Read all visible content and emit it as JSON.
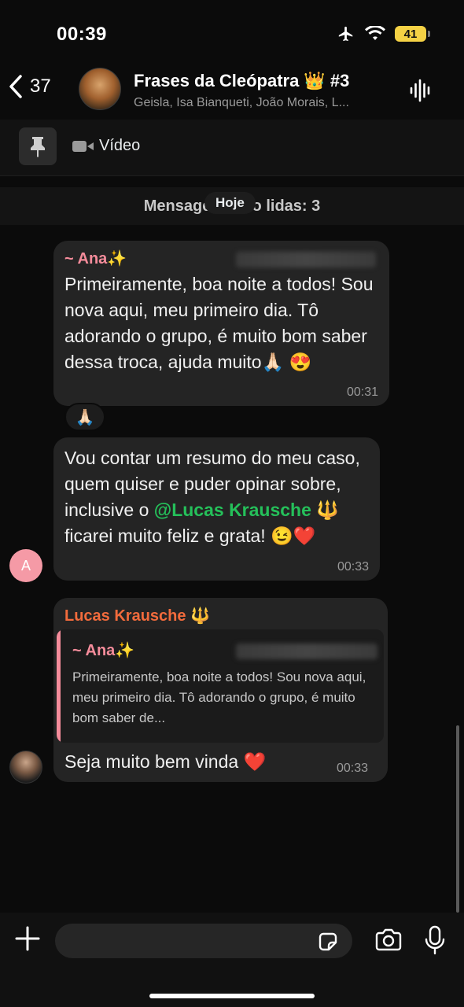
{
  "status_bar": {
    "time": "00:39",
    "battery": "41"
  },
  "header": {
    "back_count": "37",
    "title": "Frases da Cleópatra 👑 #3",
    "members": "Geisla, Isa Bianqueti, João Morais, L..."
  },
  "pinned": {
    "label": "Vídeo"
  },
  "unread": {
    "text": "Mensagens não lidas: 3",
    "date_chip": "Hoje"
  },
  "messages": [
    {
      "sender": "~ Ana✨",
      "text": "Primeiramente, boa noite a todos! Sou nova aqui, meu primeiro dia. Tô adorando o grupo, é muito bom saber dessa troca, ajuda muito🙏🏻 😍",
      "time": "00:31",
      "reaction": "🙏🏻"
    },
    {
      "text_before": "Vou contar um resumo do meu caso, quem quiser e puder opinar sobre, inclusive o ",
      "mention": "@Lucas Krausche",
      "text_after": " 🔱 ficarei muito feliz e grata! 😉❤️",
      "time": "00:33",
      "avatar_letter": "A"
    },
    {
      "sender": "Lucas Krausche 🔱",
      "quote_sender": "~ Ana✨",
      "quote_text": "Primeiramente, boa noite a todos! Sou nova aqui, meu primeiro dia. Tô adorando o grupo, é muito bom saber de...",
      "text": "Seja muito bem vinda ❤️",
      "time": "00:33"
    }
  ],
  "icons": {
    "back": "chevron-left-icon",
    "wave": "waveform-icon",
    "pin": "pin-icon",
    "video": "video-icon",
    "plus": "plus-icon",
    "sticker": "sticker-icon",
    "camera": "camera-icon",
    "mic": "microphone-icon"
  },
  "colors": {
    "ana": "#f58c9b",
    "lucas": "#f26b3c",
    "mention": "#25c05a",
    "battery": "#f5d245"
  }
}
